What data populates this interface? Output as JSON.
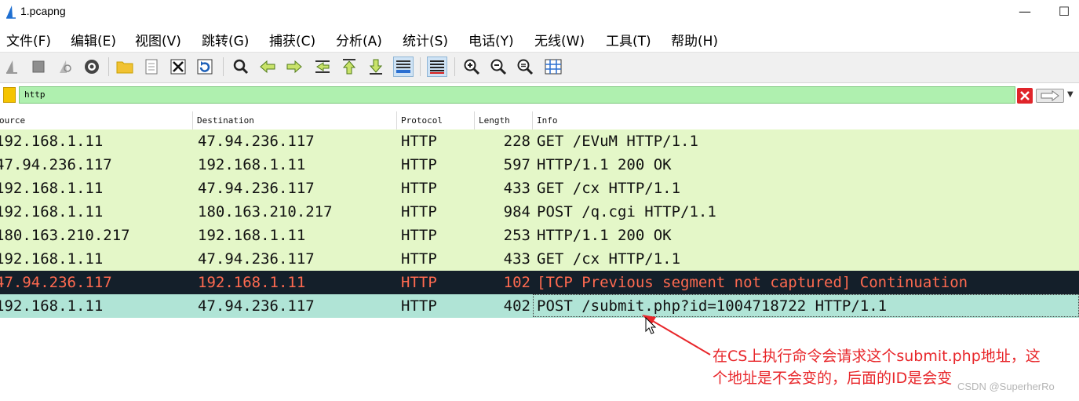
{
  "window": {
    "title": "1.pcapng",
    "minimize": "—",
    "maximize": "☐"
  },
  "menu": [
    "文件(F)",
    "编辑(E)",
    "视图(V)",
    "跳转(G)",
    "捕获(C)",
    "分析(A)",
    "统计(S)",
    "电话(Y)",
    "无线(W)",
    "工具(T)",
    "帮助(H)"
  ],
  "toolbar": {
    "buttons": [
      "start-capture-icon",
      "stop-capture-icon",
      "restart-capture-icon",
      "capture-options-icon",
      "open-file-icon",
      "file-set-icon",
      "close-file-icon",
      "reload-icon",
      "find-packet-icon",
      "go-back-icon",
      "go-forward-icon",
      "go-to-packet-icon",
      "first-packet-icon",
      "last-packet-icon",
      "autoscroll-icon",
      "colorize-icon",
      "zoom-in-icon",
      "zoom-out-icon",
      "normal-size-icon",
      "resize-columns-icon"
    ]
  },
  "filter": {
    "value": "http"
  },
  "columns": {
    "source": "ource",
    "destination": "Destination",
    "protocol": "Protocol",
    "length": "Length",
    "info": "Info"
  },
  "packets": [
    {
      "source": "192.168.1.11",
      "destination": "47.94.236.117",
      "protocol": "HTTP",
      "length": "228",
      "info": "GET /EVuM HTTP/1.1"
    },
    {
      "source": "47.94.236.117",
      "destination": "192.168.1.11",
      "protocol": "HTTP",
      "length": "597",
      "info": "HTTP/1.1 200 OK"
    },
    {
      "source": "192.168.1.11",
      "destination": "47.94.236.117",
      "protocol": "HTTP",
      "length": "433",
      "info": "GET /cx HTTP/1.1"
    },
    {
      "source": "192.168.1.11",
      "destination": "180.163.210.217",
      "protocol": "HTTP",
      "length": "984",
      "info": "POST /q.cgi HTTP/1.1"
    },
    {
      "source": "180.163.210.217",
      "destination": "192.168.1.11",
      "protocol": "HTTP",
      "length": "253",
      "info": "HTTP/1.1 200 OK"
    },
    {
      "source": "192.168.1.11",
      "destination": "47.94.236.117",
      "protocol": "HTTP",
      "length": "433",
      "info": "GET /cx HTTP/1.1"
    },
    {
      "source": "47.94.236.117",
      "destination": "192.168.1.11",
      "protocol": "HTTP",
      "length": "102",
      "info": "[TCP Previous segment not captured] Continuation"
    },
    {
      "source": "192.168.1.11",
      "destination": "47.94.236.117",
      "protocol": "HTTP",
      "length": "402",
      "info": "POST /submit.php?id=1004718722 HTTP/1.1"
    }
  ],
  "colors": {
    "row_normal": "#e4f7c8",
    "row_error": "#141f2a",
    "row_error_text": "#ff6a50",
    "row_selected": "#b0e4d6",
    "filter_bg": "#aff0af",
    "annotation": "#e8262a"
  },
  "annotation": {
    "line1": "在CS上执行命令会请求这个submit.php地址，这",
    "line2": "个地址是不会变的，后面的ID是会变"
  },
  "watermark": "CSDN @SuperherRo"
}
